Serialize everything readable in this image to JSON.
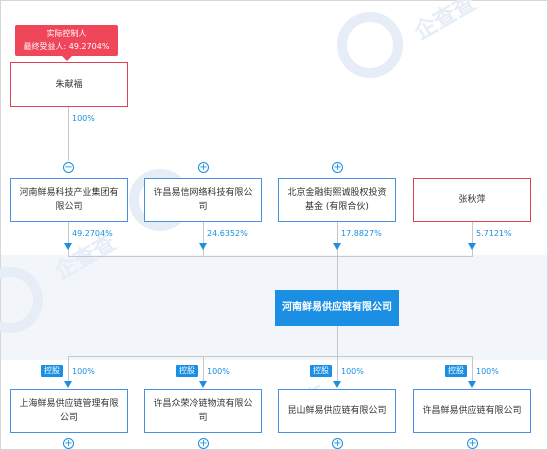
{
  "controller_badge": {
    "line1": "实际控制人",
    "line2": "最终受益人: 49.2704%"
  },
  "controller": {
    "name": "朱献福"
  },
  "controller_link_pct": "100%",
  "shareholders": [
    {
      "name": "河南鲜易科技产业集团有限公司",
      "pct": "49.2704%",
      "toggle": "−"
    },
    {
      "name": "许昌易信网络科技有限公司",
      "pct": "24.6352%",
      "toggle": "+"
    },
    {
      "name": "北京金融街熙诚股权投资基金 (有限合伙)",
      "pct": "17.8827%",
      "toggle": "+"
    },
    {
      "name": "张秋萍",
      "pct": "5.7121%",
      "toggle": ""
    }
  ],
  "center": {
    "name": "河南鲜易供应链有限公司"
  },
  "subsidiaries": [
    {
      "tag": "控股",
      "pct": "100%",
      "name": "上海鲜易供应链管理有限公司",
      "toggle": "+"
    },
    {
      "tag": "控股",
      "pct": "100%",
      "name": "许昌众荣冷链物流有限公司",
      "toggle": "+"
    },
    {
      "tag": "控股",
      "pct": "100%",
      "name": "昆山鲜易供应链有限公司",
      "toggle": "+"
    },
    {
      "tag": "控股",
      "pct": "100%",
      "name": "许昌鲜易供应链有限公司",
      "toggle": "+"
    }
  ],
  "colors": {
    "accent": "#1a8fe3",
    "badge": "#f0465a",
    "person_border": "#e0405a"
  }
}
